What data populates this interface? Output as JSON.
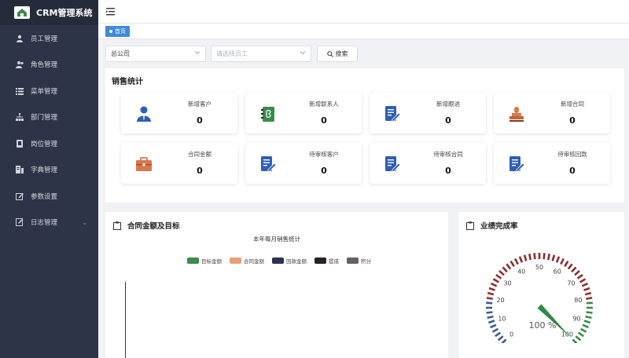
{
  "app": {
    "title": "CRM管理系统"
  },
  "sidebar": {
    "items": [
      {
        "label": "员工管理",
        "icon": "user-icon"
      },
      {
        "label": "角色管理",
        "icon": "users-icon"
      },
      {
        "label": "菜单管理",
        "icon": "menu-list-icon"
      },
      {
        "label": "部门管理",
        "icon": "sitemap-icon"
      },
      {
        "label": "岗位管理",
        "icon": "book-icon"
      },
      {
        "label": "字典管理",
        "icon": "dictionary-icon"
      },
      {
        "label": "参数设置",
        "icon": "edit-icon"
      },
      {
        "label": "日志管理",
        "icon": "log-icon",
        "chevron": "⌄"
      }
    ]
  },
  "tags": {
    "home": "首页"
  },
  "filters": {
    "company": "总公司",
    "employee_placeholder": "请选择员工",
    "search": "搜索"
  },
  "sales": {
    "title": "销售统计",
    "cards": [
      {
        "label": "新增客户",
        "value": "0",
        "icon": "person-icon"
      },
      {
        "label": "新增联系人",
        "value": "0",
        "icon": "contacts-book-icon"
      },
      {
        "label": "新增跟进",
        "value": "0",
        "icon": "document-edit-icon"
      },
      {
        "label": "新增合同",
        "value": "0",
        "icon": "stamp-icon"
      },
      {
        "label": "合同金额",
        "value": "0",
        "icon": "briefcase-icon"
      },
      {
        "label": "待审核客户",
        "value": "0",
        "icon": "document-edit-icon"
      },
      {
        "label": "待审核合同",
        "value": "0",
        "icon": "document-edit-icon"
      },
      {
        "label": "待审核回款",
        "value": "0",
        "icon": "document-edit-icon"
      }
    ]
  },
  "contract_chart": {
    "panel_title": "合同金额及目标",
    "chart_title": "本年每月销售统计",
    "legend": [
      {
        "name": "目标金额",
        "color": "#3e8a4c"
      },
      {
        "name": "合同金额",
        "color": "#e8a07a"
      },
      {
        "name": "回款金额",
        "color": "#2b3350"
      },
      {
        "name": "提成",
        "color": "#2a2128"
      },
      {
        "name": "积分",
        "color": "#6a5e66"
      }
    ]
  },
  "performance": {
    "panel_title": "业绩完成率",
    "gauge": {
      "value": 100,
      "readout": "100 %",
      "min": 0,
      "max": 100,
      "ticks": [
        "0",
        "10",
        "20",
        "30",
        "40",
        "50",
        "60",
        "70",
        "80",
        "90",
        "100"
      ],
      "colors": {
        "low": "#3f5b8a",
        "mid": "#8a3030",
        "high": "#3e8a4c",
        "pointer": "#2e8a45"
      }
    }
  }
}
